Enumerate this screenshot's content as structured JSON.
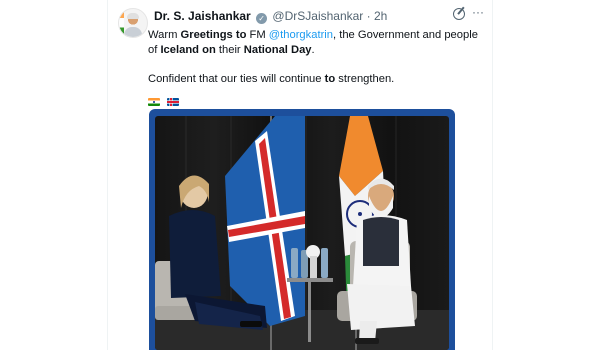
{
  "tweet": {
    "author_name": "Dr. S. Jaishankar",
    "handle": "@DrSJaishankar",
    "separator": "·",
    "time": "2h",
    "more_glyph": "···",
    "para1": [
      {
        "t": "Warm ",
        "s": "normal"
      },
      {
        "t": "Greetings to",
        "s": "bold"
      },
      {
        "t": " FM ",
        "s": "normal"
      },
      {
        "t": "@thorgkatrin",
        "s": "mention"
      },
      {
        "t": ", the Government and people of ",
        "s": "normal"
      },
      {
        "t": "Iceland on",
        "s": "bold"
      },
      {
        "t": " their ",
        "s": "normal"
      },
      {
        "t": "National Day",
        "s": "bold"
      },
      {
        "t": ".",
        "s": "normal"
      }
    ],
    "para2": [
      {
        "t": "Confident that our ties will continue ",
        "s": "normal"
      },
      {
        "t": "to",
        "s": "bold"
      },
      {
        "t": " strengthen.",
        "s": "normal"
      }
    ],
    "flags": [
      "india-flag-icon",
      "iceland-flag-icon"
    ],
    "image": "photo-of-bilateral-meeting"
  },
  "colors": {
    "text": "#0f1419",
    "secondary": "#536471",
    "link": "#1d9bf0",
    "photo_frame": "#1d4f9c"
  }
}
